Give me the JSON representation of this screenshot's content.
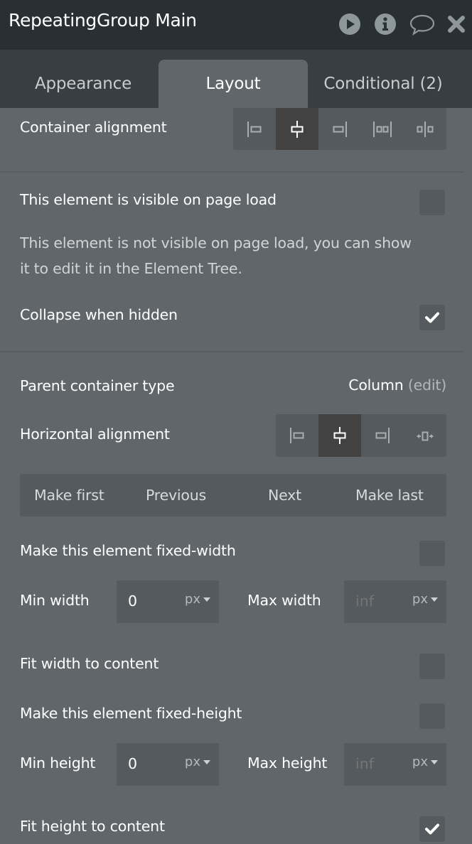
{
  "header": {
    "title": "RepeatingGroup Main",
    "icons": [
      "play-icon",
      "info-icon",
      "comment-icon",
      "close-icon"
    ]
  },
  "tabs": [
    {
      "label": "Appearance",
      "active": false
    },
    {
      "label": "Layout",
      "active": true
    },
    {
      "label": "Conditional (2)",
      "active": false
    }
  ],
  "container_alignment": {
    "label": "Container alignment",
    "options": [
      "align-left",
      "align-center",
      "align-right",
      "space-between",
      "space-around"
    ],
    "selected": "align-center"
  },
  "visibility": {
    "visible_on_load_label": "This element is visible on page load",
    "visible_on_load": false,
    "helper_text": "This element is not visible on page load, you can show it to edit it in the Element Tree.",
    "collapse_label": "Collapse when hidden",
    "collapse": true
  },
  "parent_container": {
    "label": "Parent container type",
    "value": "Column",
    "edit_label": "(edit)"
  },
  "horizontal_alignment": {
    "label": "Horizontal alignment",
    "options": [
      "align-left",
      "align-center",
      "align-right",
      "stretch"
    ],
    "selected": "align-center"
  },
  "order_buttons": [
    "Make first",
    "Previous",
    "Next",
    "Make last"
  ],
  "width": {
    "fixed_label": "Make this element fixed-width",
    "fixed": false,
    "min_label": "Min width",
    "min_value": "0",
    "min_unit": "px",
    "max_label": "Max width",
    "max_placeholder": "inf",
    "max_unit": "px",
    "fit_label": "Fit width to content",
    "fit": false
  },
  "height": {
    "fixed_label": "Make this element fixed-height",
    "fixed": false,
    "min_label": "Min height",
    "min_value": "0",
    "min_unit": "px",
    "max_label": "Max height",
    "max_placeholder": "inf",
    "max_unit": "px",
    "fit_label": "Fit height to content",
    "fit": true
  }
}
